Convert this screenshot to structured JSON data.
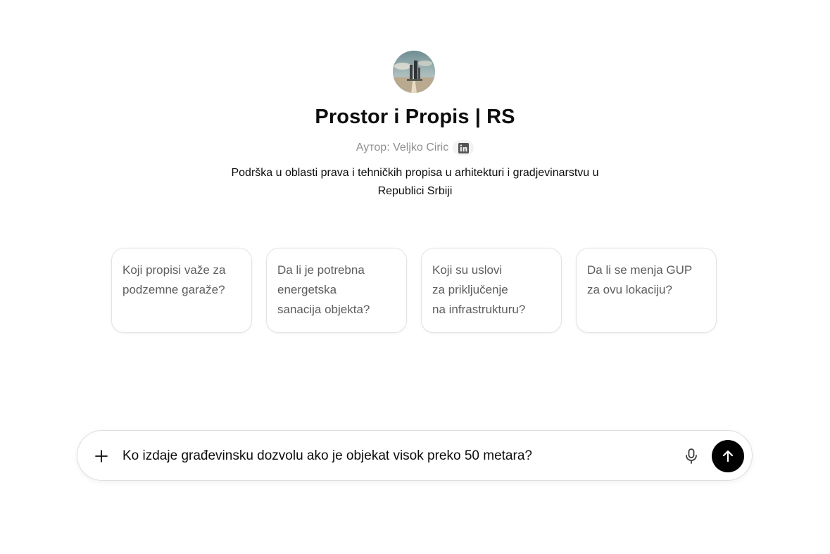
{
  "gpt": {
    "avatar_icon": "landscape-avatar-icon",
    "title": "Prostor i Propis | RS",
    "author_label": "Аутор: Veljko Ciric",
    "author_link_icon": "linkedin-icon",
    "description": "Podrška u oblasti prava i tehničkih propisa u arhitekturi i gradjevinarstvu u Republici Srbiji"
  },
  "suggestions": [
    {
      "text": "Koji propisi važe za\npodzemne garaže?"
    },
    {
      "text": "Da li je potrebna\nenergetska\nsanacija objekta?"
    },
    {
      "text": "Koji su uslovi\nza priključenje\nna infrastrukturu?"
    },
    {
      "text": "Da li se menja GUP\nza ovu lokaciju?"
    }
  ],
  "composer": {
    "value": "Ko izdaje građevinsku dozvolu ako je objekat visok preko 50 metara?",
    "plus_icon": "plus-icon",
    "mic_icon": "microphone-icon",
    "send_icon": "arrow-up-icon"
  },
  "colors": {
    "title": "#0d0d0d",
    "muted": "#8f8f8f",
    "card_text": "#5d5d5d",
    "card_border": "#e3e3e3",
    "send_button": "#000000"
  }
}
